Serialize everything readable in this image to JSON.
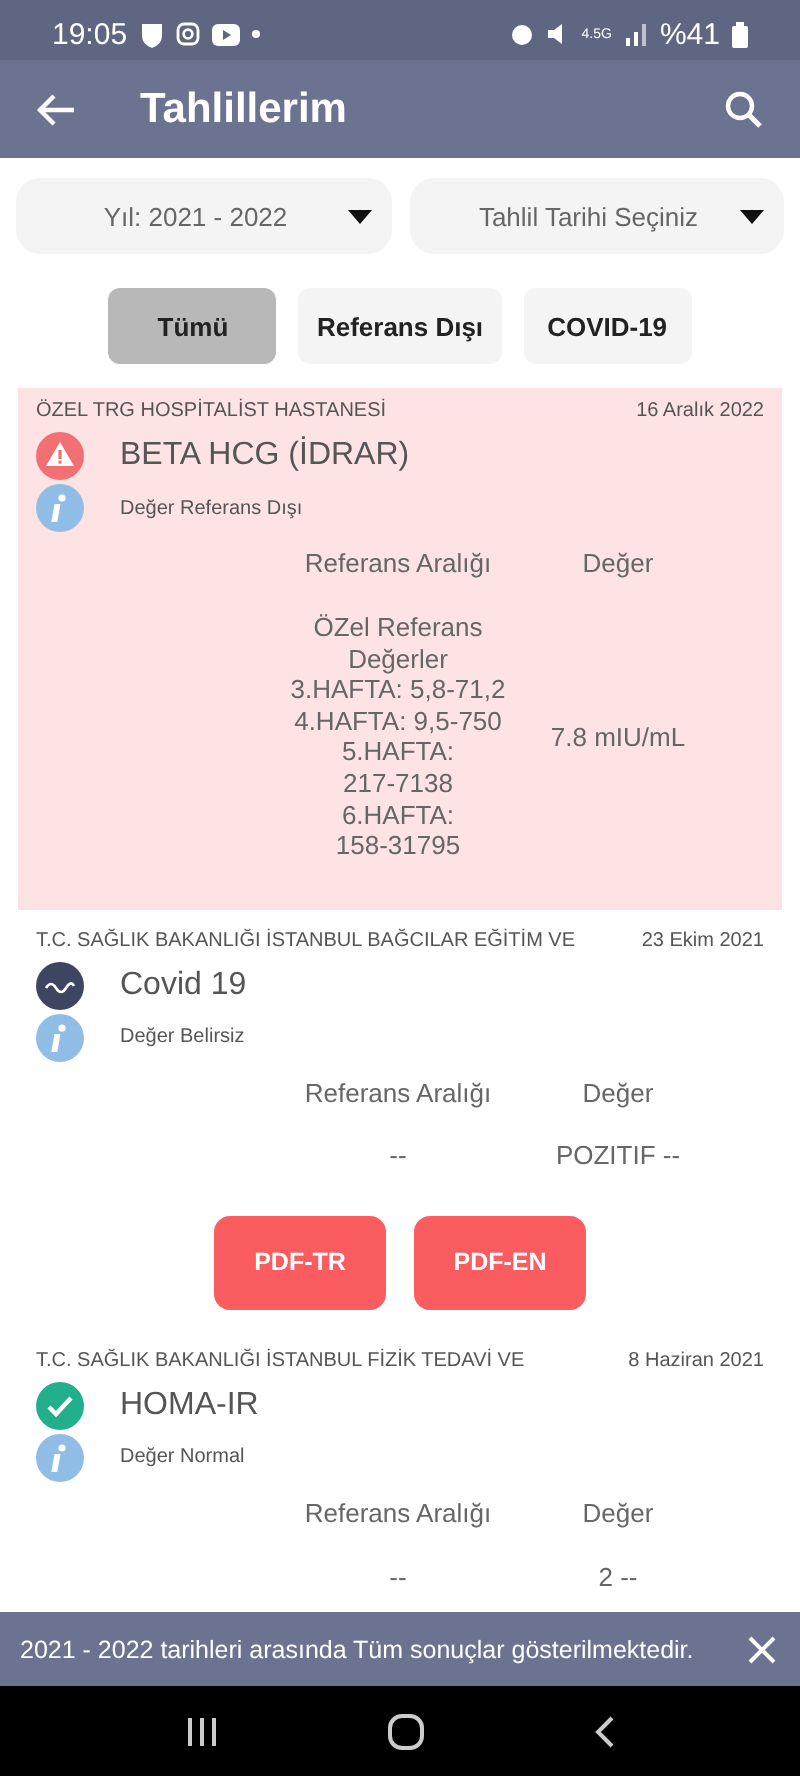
{
  "status_bar": {
    "time": "19:05",
    "network": "4.5G",
    "battery": "%41"
  },
  "app_bar": {
    "title": "Tahlillerim"
  },
  "dropdowns": [
    {
      "label": "Yıl: 2021 - 2022"
    },
    {
      "label": "Tahlil Tarihi Seçiniz"
    }
  ],
  "filters": [
    {
      "label": "Tümü",
      "selected": true
    },
    {
      "label": "Referans Dışı",
      "selected": false
    },
    {
      "label": "COVID-19",
      "selected": false
    }
  ],
  "results": [
    {
      "kind": "warning",
      "highlighted": true,
      "hospital": "ÖZEL TRG HOSPİTALİST HASTANESİ",
      "date": "16 Aralık 2022",
      "name": "BETA HCG (İDRAR)",
      "status": "Değer Referans Dışı",
      "range_header": "Referans Aralığı",
      "value_header": "Değer",
      "range_lines": [
        "ÖZel Referans",
        "Değerler",
        "3.HAFTA: 5,8-71,2",
        "4.HAFTA: 9,5-750",
        "5.HAFTA:",
        "217-7138",
        "6.HAFTA:",
        "158-31795"
      ],
      "value": "7.8 mIU/mL"
    },
    {
      "kind": "covid",
      "highlighted": false,
      "hospital": "T.C. SAĞLIK BAKANLIĞI İSTANBUL BAĞCILAR EĞİTİM VE",
      "date": "23 Ekim 2021",
      "name": "Covid 19",
      "status": "Değer Belirsiz",
      "range_header": "Referans Aralığı",
      "value_header": "Değer",
      "range_lines": [
        "--"
      ],
      "value": "POZITIF --",
      "buttons": [
        "PDF-TR",
        "PDF-EN"
      ]
    },
    {
      "kind": "normal",
      "highlighted": false,
      "hospital": "T.C. SAĞLIK BAKANLIĞI  İSTANBUL FİZİK TEDAVİ VE",
      "date": "8 Haziran 2021",
      "name": "HOMA-IR",
      "status": "Değer Normal",
      "range_header": "Referans Aralığı",
      "value_header": "Değer",
      "range_lines": [
        "--"
      ],
      "value": "2 --"
    }
  ],
  "snackbar": {
    "message": "2021 - 2022 tarihleri arasında Tüm sonuçlar gösterilmektedir."
  }
}
